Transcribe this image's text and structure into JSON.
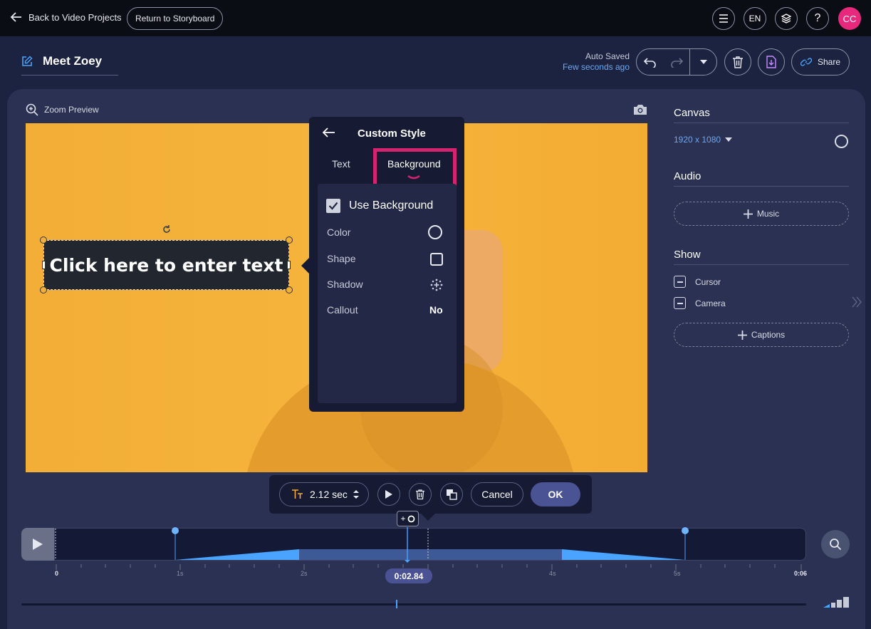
{
  "topbar": {
    "back_label": "Back to Video Projects",
    "storyboard_label": "Return to Storyboard",
    "language": "EN",
    "help": "?",
    "avatar_initials": "CC"
  },
  "header": {
    "project_title": "Meet Zoey",
    "autosave_label": "Auto Saved",
    "autosave_time": "Few seconds ago",
    "share_label": "Share"
  },
  "preview": {
    "zoom_label": "Zoom Preview",
    "text_box": "Click here to enter text"
  },
  "custom_style": {
    "title": "Custom Style",
    "tabs": [
      "Text",
      "Background"
    ],
    "active_tab": "Background",
    "use_background_label": "Use Background",
    "use_background_checked": true,
    "options": [
      {
        "label": "Color",
        "value_icon": "circle-icon"
      },
      {
        "label": "Shape",
        "value_icon": "square-icon"
      },
      {
        "label": "Shadow",
        "value_icon": "shadow-dots-icon"
      },
      {
        "label": "Callout",
        "value": "No"
      }
    ]
  },
  "sidebar": {
    "canvas_heading": "Canvas",
    "canvas_size": "1920 x 1080",
    "audio_heading": "Audio",
    "music_label": "Music",
    "show_heading": "Show",
    "show_items": [
      "Cursor",
      "Camera"
    ],
    "captions_label": "Captions"
  },
  "toolbar": {
    "duration": "2.12 sec",
    "cancel_label": "Cancel",
    "ok_label": "OK"
  },
  "timeline": {
    "add_label": "+",
    "playhead_time": "0:02.84",
    "tick_labels": [
      "0",
      "1s",
      "2s",
      "4s",
      "5s",
      "0:06"
    ]
  },
  "colors": {
    "accent_pink": "#d5246f",
    "accent_blue": "#6fa6ee",
    "canvas_bg": "#f2ae36"
  }
}
